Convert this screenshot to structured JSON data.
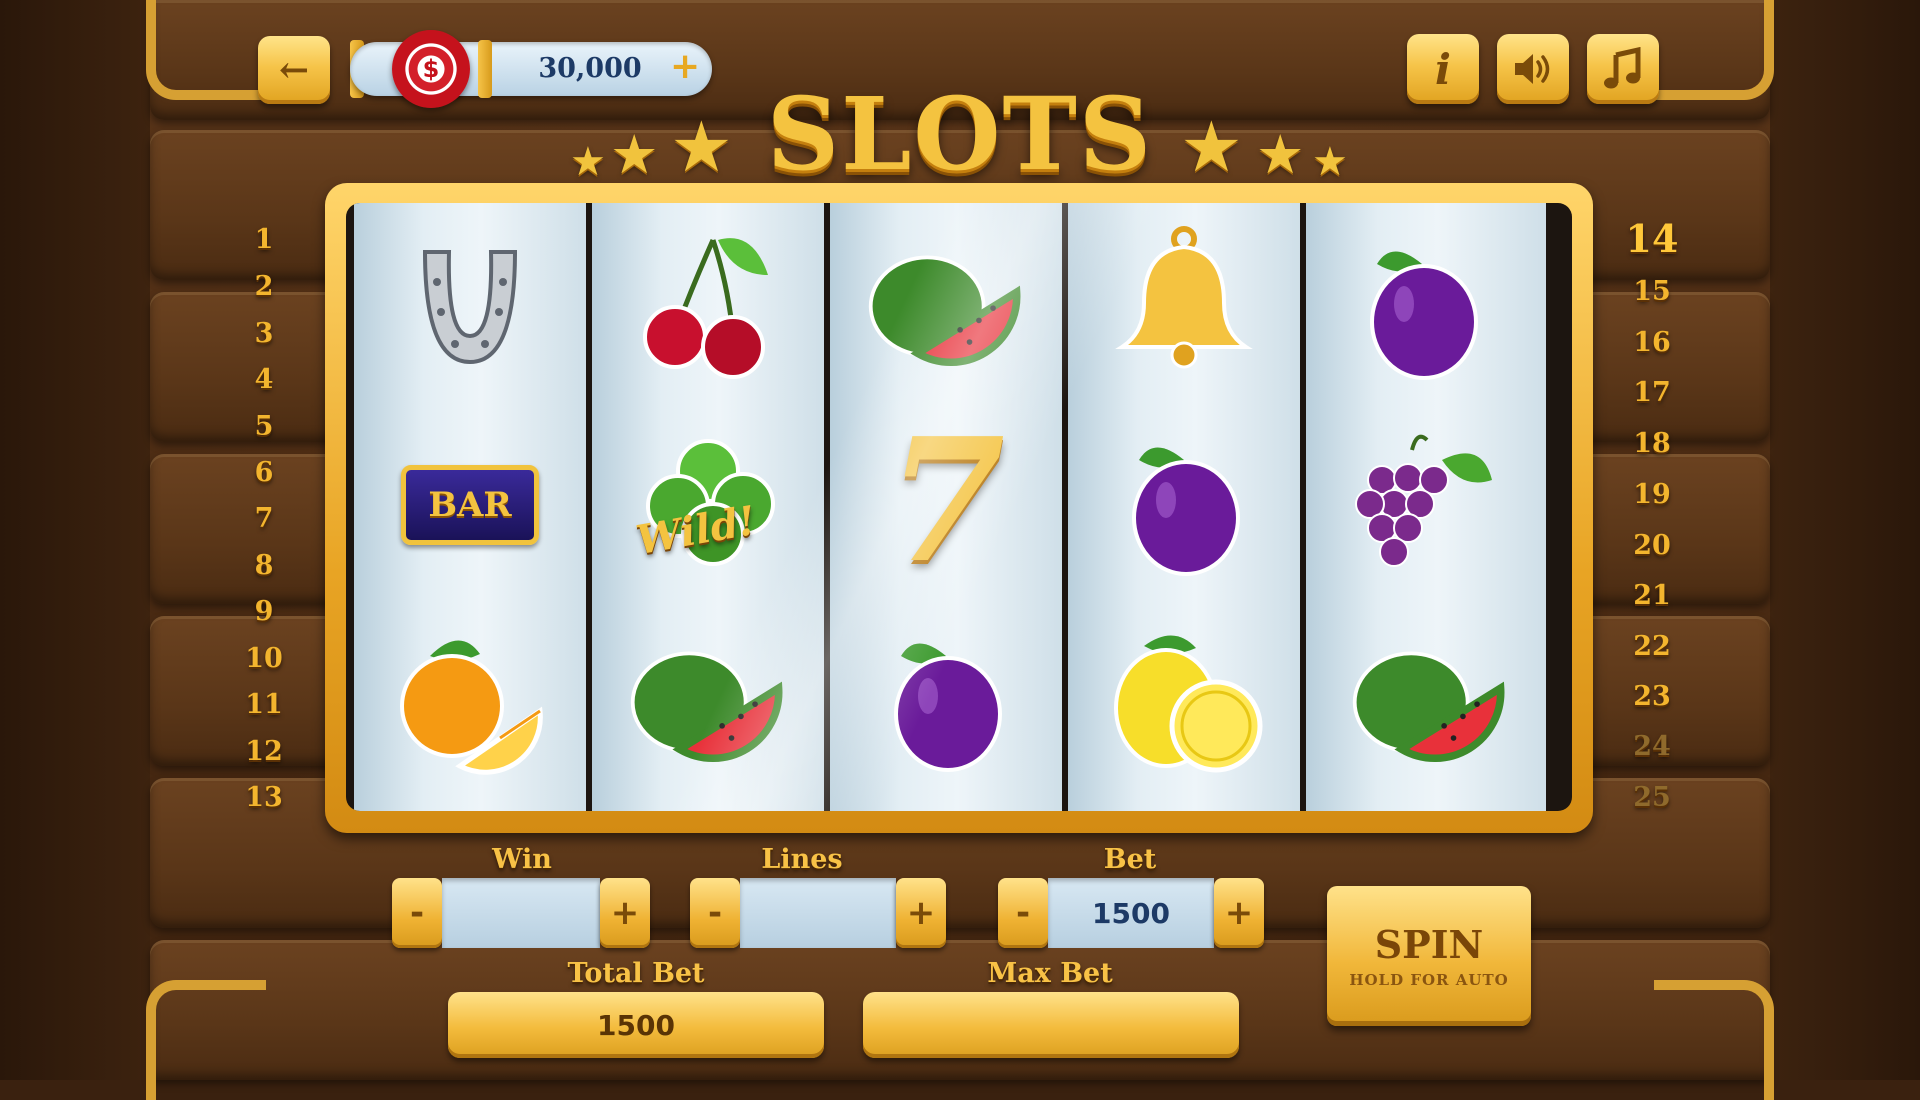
{
  "title": "SLOTS",
  "header": {
    "balance": "30,000",
    "balance_plus": "+",
    "chip_symbol": "$",
    "info_glyph": "i",
    "sound_glyph": "🔊",
    "music_glyph": "♫",
    "back_glyph": "←"
  },
  "reels": [
    [
      "horseshoe",
      "bar",
      "orange"
    ],
    [
      "cherries",
      "wild-clover",
      "watermelon"
    ],
    [
      "watermelon",
      "seven",
      "plum"
    ],
    [
      "bell",
      "plum",
      "lemon"
    ],
    [
      "plum",
      "grapes",
      "watermelon"
    ]
  ],
  "symbol_text": {
    "bar": "BAR",
    "wild": "Wild!",
    "seven": "7"
  },
  "paylines_left": [
    "1",
    "2",
    "3",
    "4",
    "5",
    "6",
    "7",
    "8",
    "9",
    "10",
    "11",
    "12",
    "13"
  ],
  "paylines_right": [
    "14",
    "15",
    "16",
    "17",
    "18",
    "19",
    "20",
    "21",
    "22",
    "23",
    "24",
    "25"
  ],
  "active_line": "14",
  "controls": {
    "win": {
      "label": "Win",
      "value": "",
      "minus": "-",
      "plus": "+"
    },
    "lines": {
      "label": "Lines",
      "value": "",
      "minus": "-",
      "plus": "+"
    },
    "bet": {
      "label": "Bet",
      "value": "1500",
      "minus": "-",
      "plus": "+"
    },
    "total_bet": {
      "label": "Total Bet",
      "value": "1500"
    },
    "max_bet": {
      "label": "Max Bet",
      "value": ""
    },
    "spin": {
      "label": "SPIN",
      "sublabel": "HOLD FOR AUTO"
    }
  },
  "colors": {
    "gold": "#f4c340",
    "wood": "#5a3618",
    "reel_bg": "#e3eef4",
    "text_blue": "#1d3a66"
  }
}
